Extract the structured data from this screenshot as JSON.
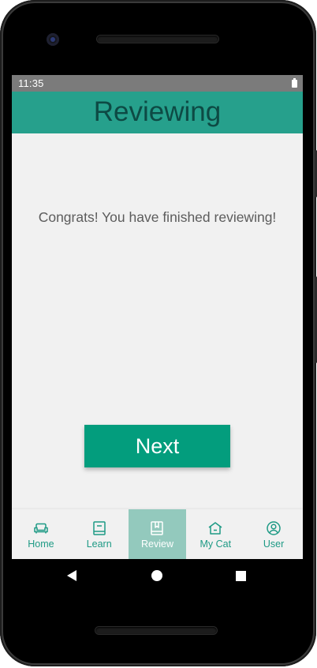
{
  "status_bar": {
    "time": "11:35",
    "battery_icon": "battery-full-icon"
  },
  "app_bar": {
    "title": "Reviewing"
  },
  "main": {
    "message": "Congrats! You have finished reviewing!",
    "next_button_label": "Next"
  },
  "bottom_nav": {
    "items": [
      {
        "label": "Home",
        "icon": "sofa-icon",
        "active": false
      },
      {
        "label": "Learn",
        "icon": "book-icon",
        "active": false
      },
      {
        "label": "Review",
        "icon": "bookmark-book-icon",
        "active": true
      },
      {
        "label": "My Cat",
        "icon": "house-icon",
        "active": false
      },
      {
        "label": "User",
        "icon": "user-circle-icon",
        "active": false
      }
    ]
  },
  "colors": {
    "primary": "#26a08c",
    "title_text": "#0d4a44",
    "button": "#039d7d",
    "nav_active_bg": "#93c9bd",
    "nav_inactive": "#1e9a85"
  }
}
